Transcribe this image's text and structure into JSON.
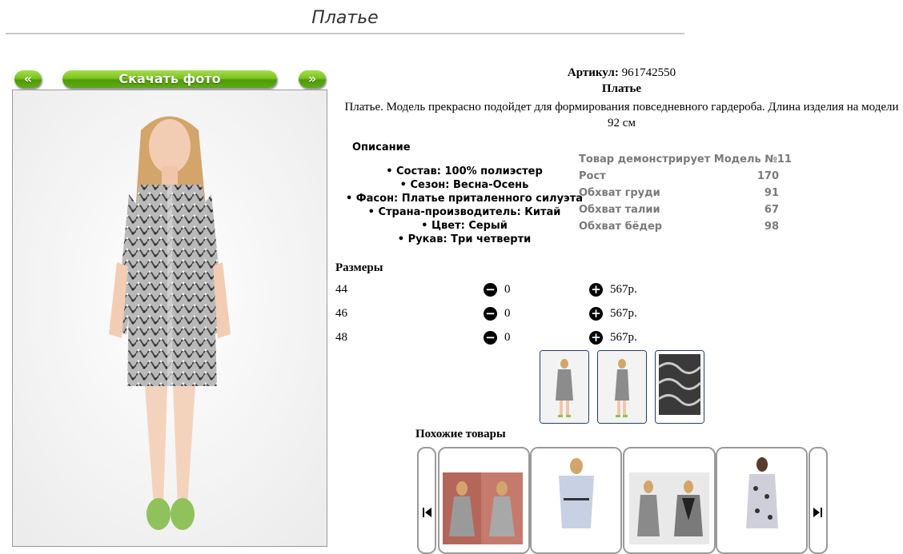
{
  "header": {
    "title": "Платье"
  },
  "nav": {
    "prev_label": "«",
    "download_label": "Скачать фото",
    "next_label": "»"
  },
  "product": {
    "sku_label": "Артикул:",
    "sku_value": "961742550",
    "name": "Платье",
    "description": "Платье. Модель прекрасно подойдет для формирования повседневного гардероба. Длина изделия на модели 92 см"
  },
  "specs": {
    "heading": "Описание",
    "items": [
      "• Состав: 100% полиэстер",
      "• Сезон: Весна-Осень",
      "• Фасон: Платье приталенного силуэта",
      "• Страна-производитель: Китай",
      "• Цвет: Серый",
      "• Рукав: Три четверти"
    ]
  },
  "model": {
    "heading": "Товар демонстрирует Модель №11",
    "rows": [
      {
        "label": "Рост",
        "value": "170"
      },
      {
        "label": "Обхват груди",
        "value": "91"
      },
      {
        "label": "Обхват талии",
        "value": "67"
      },
      {
        "label": "Обхват бёдер",
        "value": "98"
      }
    ]
  },
  "sizes": {
    "heading": "Размеры",
    "rows": [
      {
        "size": "44",
        "qty": "0",
        "price": "567р."
      },
      {
        "size": "46",
        "qty": "0",
        "price": "567р."
      },
      {
        "size": "48",
        "qty": "0",
        "price": "567р."
      }
    ]
  },
  "similar": {
    "heading": "Похожие товары"
  },
  "icons": {
    "minus": "minus-circle-icon",
    "plus": "plus-circle-icon",
    "carousel_prev": "skip-back-icon",
    "carousel_next": "skip-forward-icon"
  },
  "colors": {
    "button_green": "#6bb813",
    "thumb_border": "#1f3d6e"
  }
}
